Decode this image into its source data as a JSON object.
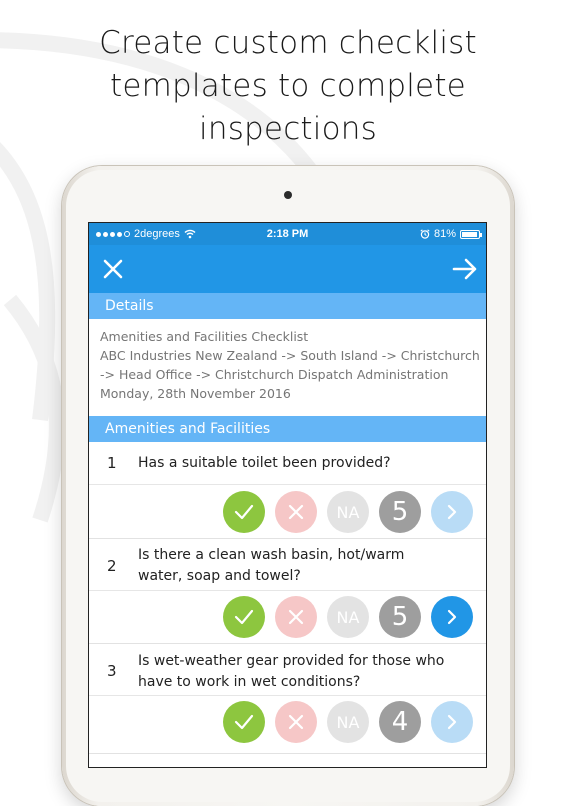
{
  "headline": {
    "line1": "Create custom checklist",
    "line2": "templates to complete",
    "line3": "inspections"
  },
  "status_bar": {
    "carrier": "2degrees",
    "time": "2:18 PM",
    "battery": "81%",
    "signal_bars": 4,
    "icons": [
      "wifi-icon",
      "alarm-icon",
      "battery-icon"
    ]
  },
  "navbar": {
    "icons": [
      "close-icon",
      "arrow-right-icon"
    ]
  },
  "details": {
    "header": "Details",
    "checklist_name": "Amenities and Facilities Checklist",
    "location_line1": "ABC Industries New Zealand -> South Island -> Christchurch",
    "location_line2": "-> Head Office -> Christchurch Dispatch Administration",
    "date": "Monday, 28th November 2016"
  },
  "section": {
    "header": "Amenities and Facilities"
  },
  "questions": [
    {
      "number": "1",
      "text_line1": "Has a suitable toilet been provided?",
      "text_line2": "",
      "na_label": "NA",
      "score": "5",
      "next_active": false
    },
    {
      "number": "2",
      "text_line1": "Is there a clean wash basin, hot/warm",
      "text_line2": "water, soap and towel?",
      "na_label": "NA",
      "score": "5",
      "next_active": true
    },
    {
      "number": "3",
      "text_line1": "Is wet-weather gear provided for those who",
      "text_line2": "have to work in wet conditions?",
      "na_label": "NA",
      "score": "4",
      "next_active": false
    }
  ],
  "colors": {
    "status_bar": "#1f8ed9",
    "nav_bar": "#2196e6",
    "section_header": "#64b5f6",
    "yes": "#8dc63f",
    "no": "#f6c7c7",
    "na": "#e3e3e3",
    "score": "#9e9e9e",
    "next_inactive": "#b9dcf6",
    "next_active": "#2196e6"
  }
}
